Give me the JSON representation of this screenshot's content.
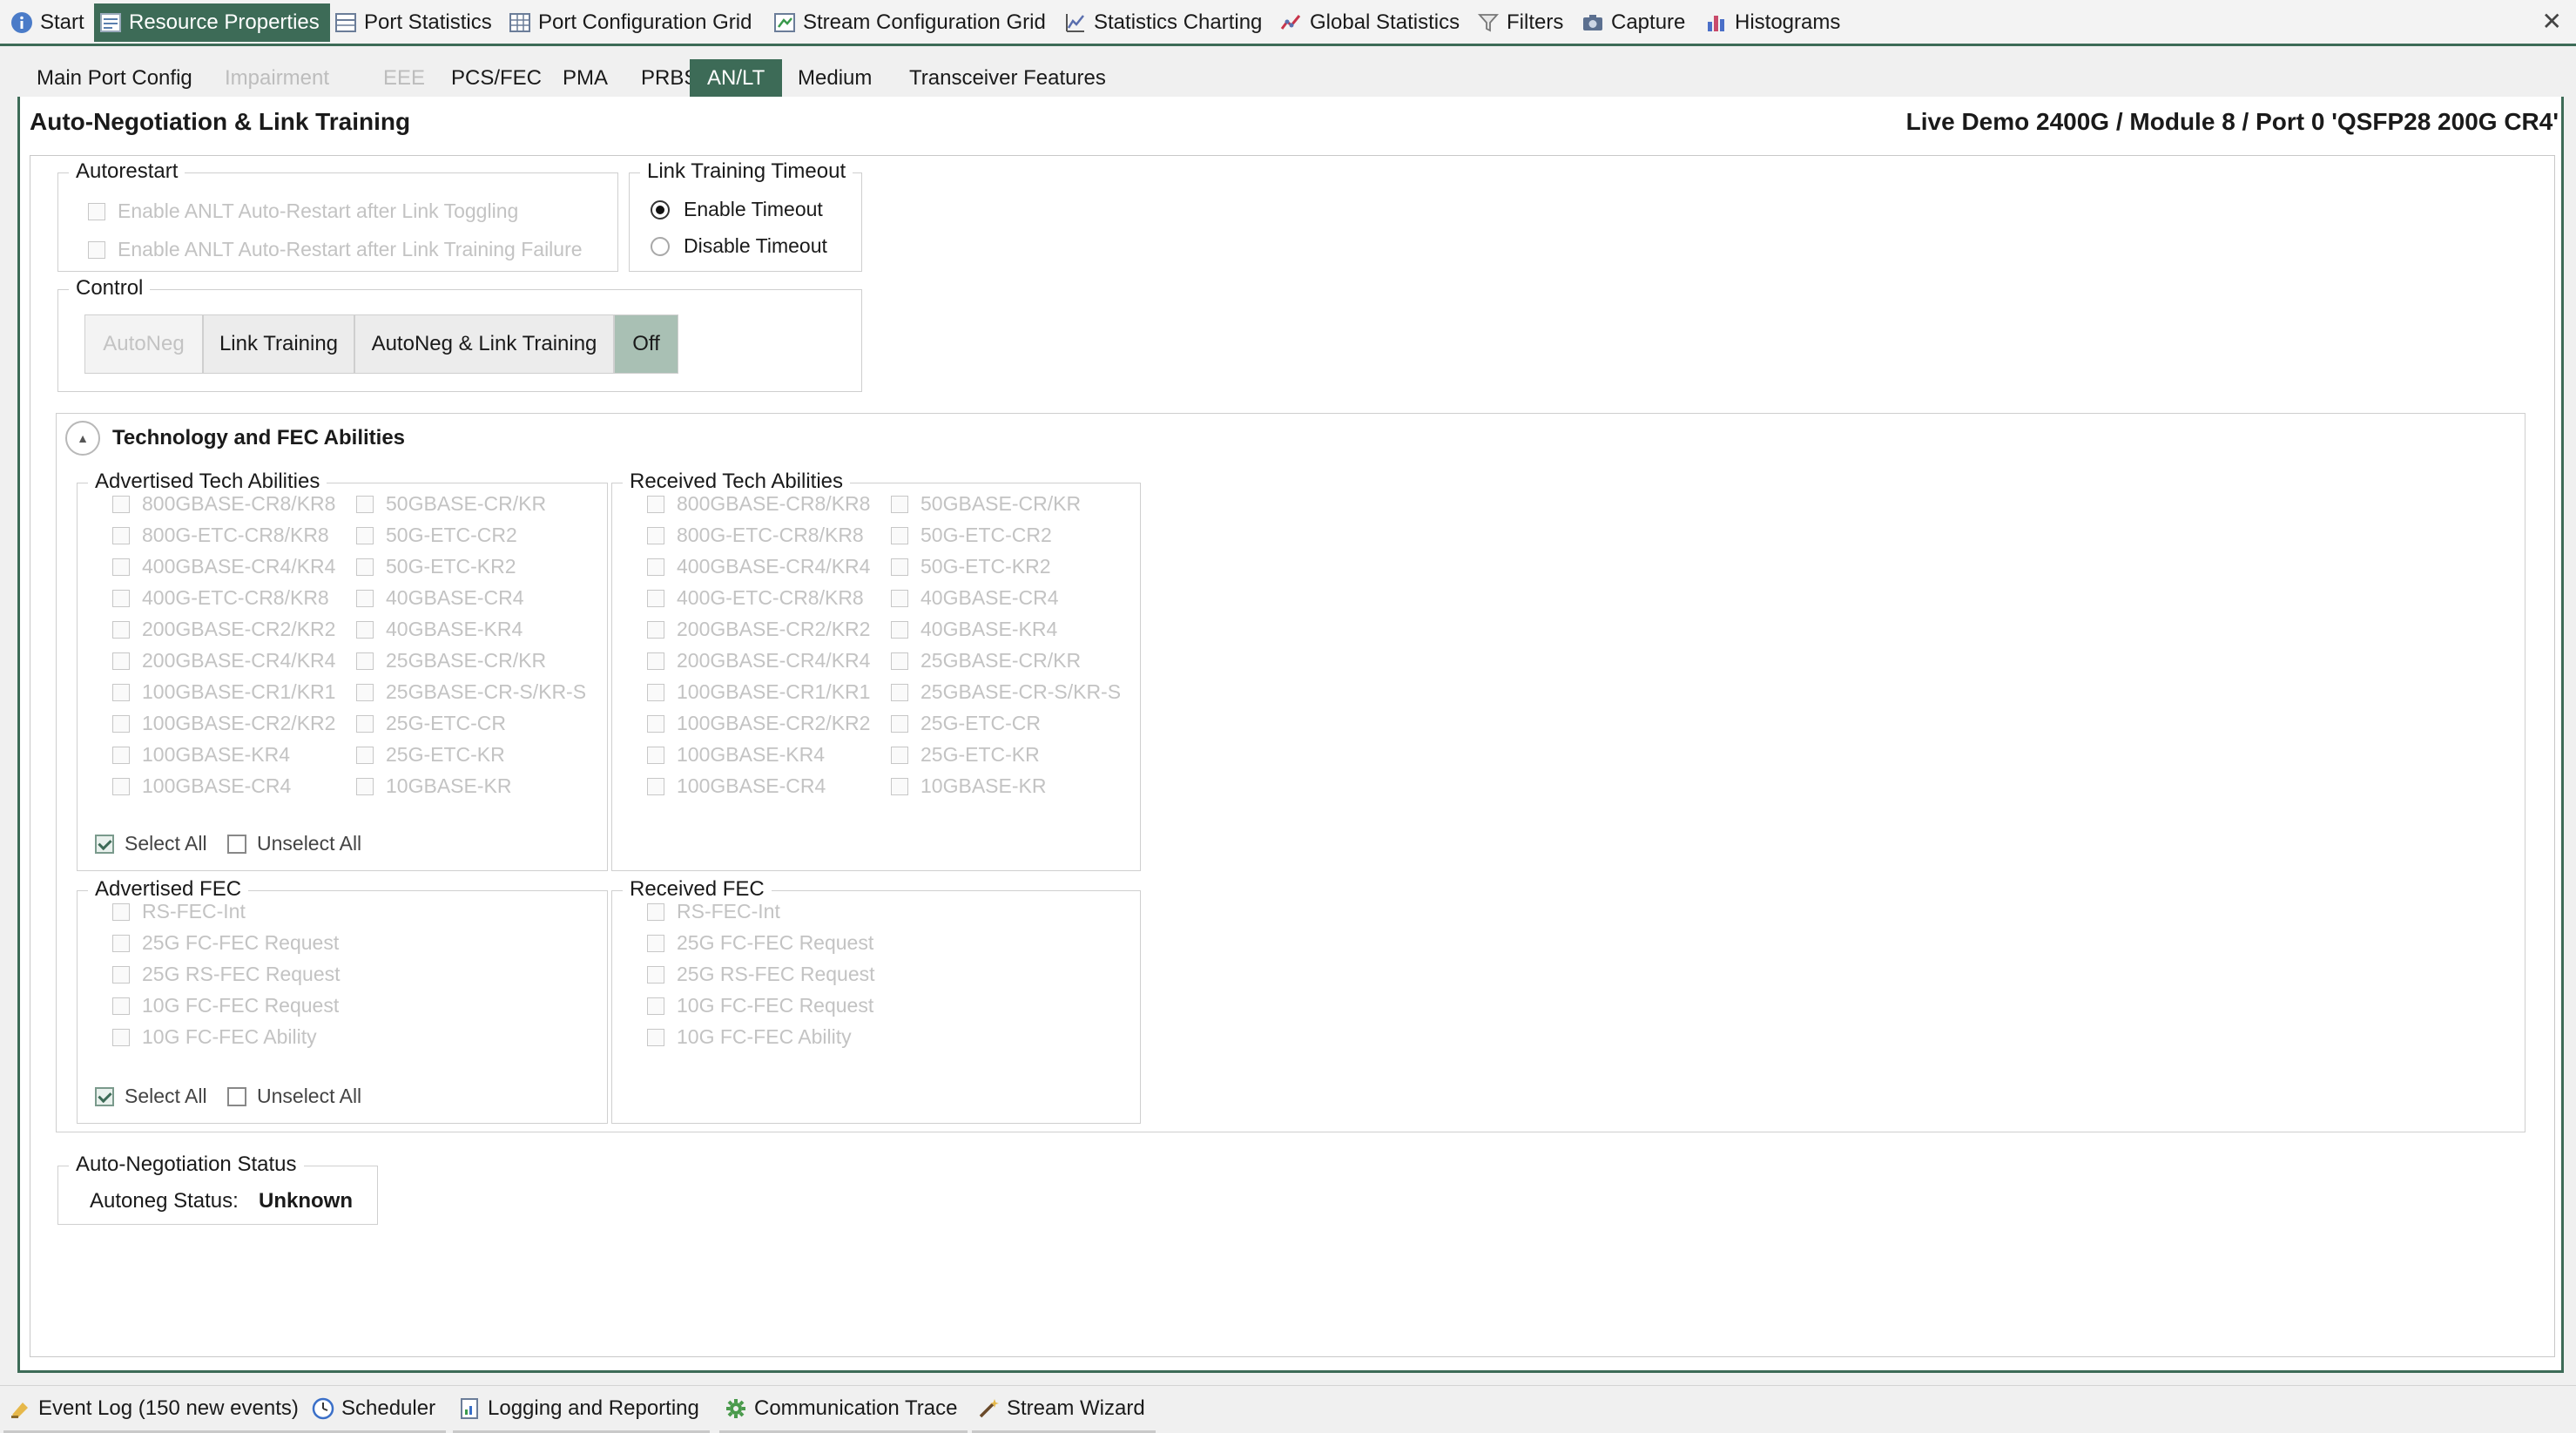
{
  "toolbar": {
    "items": [
      {
        "label": "Start",
        "icon": "info-icon"
      },
      {
        "label": "Resource Properties",
        "icon": "properties-icon"
      },
      {
        "label": "Port Statistics",
        "icon": "table-icon"
      },
      {
        "label": "Port Configuration Grid",
        "icon": "grid-icon"
      },
      {
        "label": "Stream Configuration Grid",
        "icon": "stream-grid-icon"
      },
      {
        "label": "Statistics Charting",
        "icon": "chart-icon"
      },
      {
        "label": "Global Statistics",
        "icon": "trend-icon"
      },
      {
        "label": "Filters",
        "icon": "filter-icon"
      },
      {
        "label": "Capture",
        "icon": "camera-icon"
      },
      {
        "label": "Histograms",
        "icon": "histogram-icon"
      }
    ],
    "close": "✕",
    "active_color": "#3d6b57"
  },
  "subtabs": [
    "Main Port Config",
    "Impairment",
    "EEE",
    "PCS/FEC",
    "PMA",
    "PRBS",
    "AN/LT",
    "Medium",
    "Transceiver Features"
  ],
  "page": {
    "title": "Auto-Negotiation & Link Training",
    "location": "Live Demo 2400G / Module 8 / Port 0 'QSFP28 200G CR4'"
  },
  "autorestart": {
    "legend": "Autorestart",
    "options": [
      "Enable ANLT Auto-Restart after Link Toggling",
      "Enable ANLT Auto-Restart after Link Training Failure"
    ]
  },
  "lt_timeout": {
    "legend": "Link Training Timeout",
    "options": [
      "Enable Timeout",
      "Disable Timeout"
    ],
    "selected": "Enable Timeout"
  },
  "control": {
    "legend": "Control",
    "buttons": [
      "AutoNeg",
      "Link Training",
      "AutoNeg & Link Training",
      "Off"
    ],
    "selected": "Off"
  },
  "tech": {
    "section_title": "Technology and FEC Abilities",
    "advertised_legend": "Advertised Tech Abilities",
    "received_legend": "Received Tech Abilities",
    "col1": [
      "800GBASE-CR8/KR8",
      "800G-ETC-CR8/KR8",
      "400GBASE-CR4/KR4",
      "400G-ETC-CR8/KR8",
      "200GBASE-CR2/KR2",
      "200GBASE-CR4/KR4",
      "100GBASE-CR1/KR1",
      "100GBASE-CR2/KR2",
      "100GBASE-KR4",
      "100GBASE-CR4"
    ],
    "col2": [
      "50GBASE-CR/KR",
      "50G-ETC-CR2",
      "50G-ETC-KR2",
      "40GBASE-CR4",
      "40GBASE-KR4",
      "25GBASE-CR/KR",
      "25GBASE-CR-S/KR-S",
      "25G-ETC-CR",
      "25G-ETC-KR",
      "10GBASE-KR"
    ],
    "select_all": "Select All",
    "unselect_all": "Unselect All",
    "advertised_fec_legend": "Advertised FEC",
    "received_fec_legend": "Received FEC",
    "fec": [
      "RS-FEC-Int",
      "25G FC-FEC Request",
      "25G RS-FEC Request",
      "10G FC-FEC Request",
      "10G FC-FEC Ability"
    ]
  },
  "an_status": {
    "legend": "Auto-Negotiation Status",
    "label": "Autoneg Status:",
    "value": "Unknown"
  },
  "bottombar": {
    "items": [
      {
        "label": "Event Log (150 new events)",
        "icon": "event-log-icon"
      },
      {
        "label": "Scheduler",
        "icon": "clock-icon"
      },
      {
        "label": "Logging and Reporting",
        "icon": "report-icon"
      },
      {
        "label": "Communication Trace",
        "icon": "gear-icon"
      },
      {
        "label": "Stream Wizard",
        "icon": "wand-icon"
      }
    ]
  }
}
